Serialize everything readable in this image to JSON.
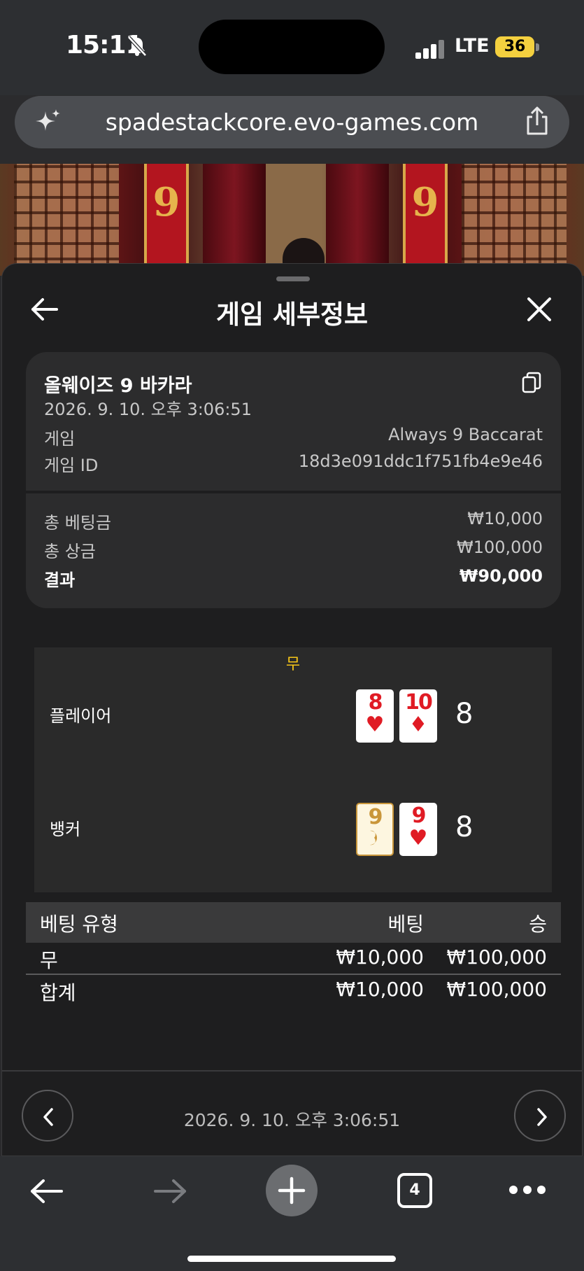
{
  "status_bar": {
    "time": "15:11",
    "network": "LTE",
    "battery": "36"
  },
  "browser": {
    "url": "spadestackcore.evo-games.com",
    "tab_count": "4"
  },
  "sheet": {
    "title": "게임 세부정보",
    "game_name": "올웨이즈 9 바카라",
    "datetime": "2026. 9. 10. 오후 3:06:51",
    "info": [
      {
        "label": "게임",
        "value": "Always 9 Baccarat"
      },
      {
        "label": "게임 ID",
        "value": "18d3e091ddc1f751fb4e9e46"
      }
    ],
    "totals": [
      {
        "label": "총 베팅금",
        "value": "₩10,000"
      },
      {
        "label": "총 상금",
        "value": "₩100,000"
      },
      {
        "label": "결과",
        "value": "₩90,000"
      }
    ]
  },
  "round": {
    "outcome": "무",
    "player": {
      "label": "플레이어",
      "cards": [
        {
          "rank": "8",
          "suit": "♥"
        },
        {
          "rank": "10",
          "suit": "♦"
        }
      ],
      "score": "8"
    },
    "banker": {
      "label": "뱅커",
      "cards": [
        {
          "rank": "9",
          "suit": ""
        },
        {
          "rank": "9",
          "suit": "♥"
        }
      ],
      "score": "8"
    }
  },
  "bets": {
    "headers": {
      "type": "베팅 유형",
      "bet": "베팅",
      "win": "승"
    },
    "rows": [
      {
        "type": "무",
        "bet": "₩10,000",
        "win": "₩100,000"
      }
    ],
    "total": {
      "type": "합계",
      "bet": "₩10,000",
      "win": "₩100,000"
    }
  },
  "footer": {
    "datetime": "2026. 9. 10. 오후 3:06:51"
  },
  "icons": {
    "sparkle": "sparkle-icon",
    "share": "share-icon",
    "back": "arrow-left-icon",
    "close": "close-icon",
    "copy": "copy-icon",
    "prev": "chevron-left-icon",
    "next": "chevron-right-icon",
    "new_tab": "plus-icon",
    "more": "more-dots-icon"
  },
  "colors": {
    "outcome": "#f5c518",
    "suit_red": "#e01b24",
    "battery": "#f4d03f"
  }
}
